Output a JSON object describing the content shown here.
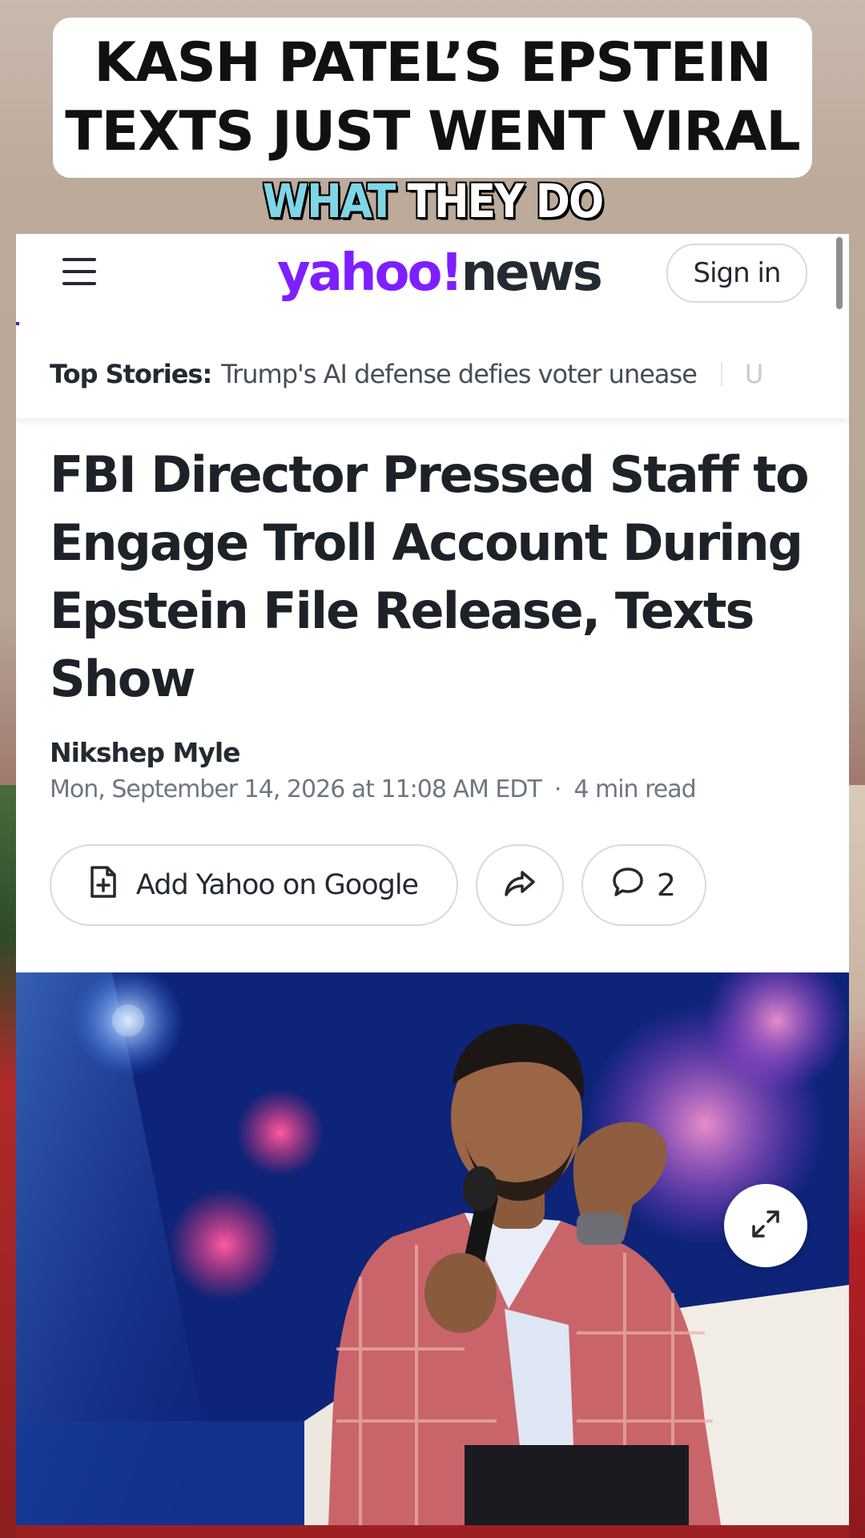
{
  "overlay": {
    "title_line1": "KASH PATEL’S EPSTEIN",
    "title_line2": "TEXTS JUST WENT VIRAL",
    "caption_word1": "WHAT",
    "caption_word2": "THEY DO"
  },
  "header": {
    "logo_part1": "yahoo!",
    "logo_part2": "news",
    "signin_label": "Sign in",
    "menu_icon": "hamburger-menu-icon"
  },
  "top_stories": {
    "label": "Top Stories:",
    "headline": "Trump's AI defense defies voter unease",
    "next_fragment": "U"
  },
  "article": {
    "headline": "FBI Director Pressed Staff to Engage Troll Account During Epstein File Release, Texts Show",
    "author": "Nikshep Myle",
    "date": "Mon, September 14, 2026 at 11:08 AM EDT",
    "separator": "·",
    "read_time": "4 min read"
  },
  "actions": {
    "add_google_label": "Add Yahoo on Google",
    "comment_count": "2",
    "icons": [
      "add-document-icon",
      "share-arrow-icon",
      "comment-bubble-icon",
      "expand-icon"
    ]
  },
  "colors": {
    "yahoo_purple": "#7e1fff",
    "text_dark": "#232a31",
    "caption_cyan": "#7fd6e6"
  }
}
